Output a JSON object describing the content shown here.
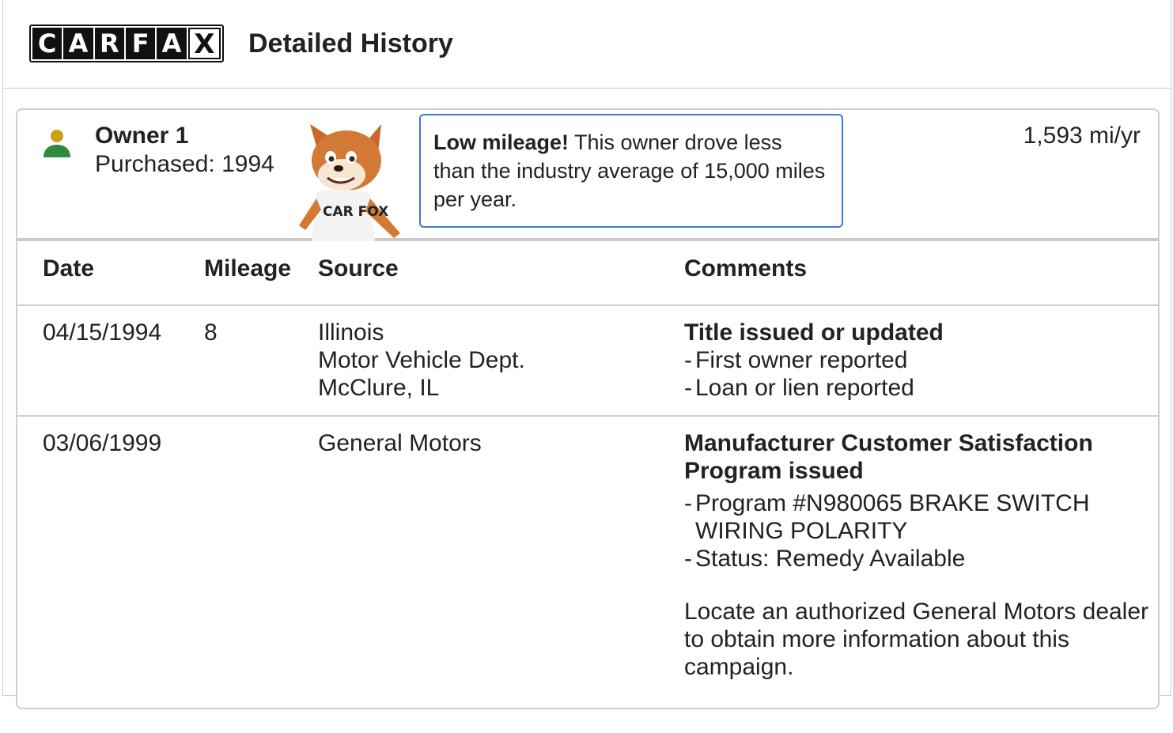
{
  "header": {
    "logo_letters": [
      "C",
      "A",
      "R",
      "F",
      "A",
      "X"
    ],
    "title": "Detailed History"
  },
  "owner": {
    "title": "Owner 1",
    "purchased": "Purchased: 1994",
    "mascot_shirt": "CAR FOX",
    "callout_bold": "Low mileage!",
    "callout_text": " This owner drove less than the industry average of 15,000 miles per year.",
    "mi_per_year": "1,593 mi/yr",
    "icon_colors": {
      "head": "#c9a116",
      "body": "#2e8b3e"
    }
  },
  "table": {
    "headers": {
      "date": "Date",
      "mileage": "Mileage",
      "source": "Source",
      "comments": "Comments"
    },
    "rows": [
      {
        "date": "04/15/1994",
        "mileage": "8",
        "source": [
          "Illinois",
          "Motor Vehicle Dept.",
          "McClure, IL"
        ],
        "comment_title": "Title issued or updated",
        "comment_items": [
          "First owner reported",
          "Loan or lien reported"
        ]
      },
      {
        "date": "03/06/1999",
        "mileage": "",
        "source": [
          "General Motors"
        ],
        "comment_title": "Manufacturer Customer Satisfaction Program issued",
        "comment_items": [
          "Program #N980065 BRAKE SWITCH WIRING POLARITY",
          "Status: Remedy Available"
        ],
        "comment_note": "Locate an authorized General Motors dealer to obtain more information about this campaign."
      }
    ]
  },
  "colors": {
    "accent": "#3a7bd5",
    "border": "#cfcfcf"
  }
}
